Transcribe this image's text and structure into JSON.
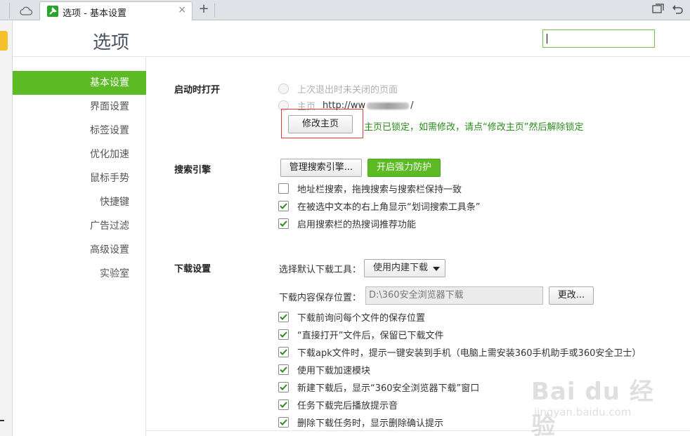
{
  "tab": {
    "title": "选项 - 基本设置",
    "close": "×",
    "new": "+"
  },
  "header": {
    "title": "选项",
    "search_value": ""
  },
  "sidebar": {
    "items": [
      {
        "label": "基本设置",
        "active": true
      },
      {
        "label": "界面设置"
      },
      {
        "label": "标签设置"
      },
      {
        "label": "优化加速"
      },
      {
        "label": "鼠标手势"
      },
      {
        "label": "快捷键"
      },
      {
        "label": "广告过滤"
      },
      {
        "label": "高级设置"
      },
      {
        "label": "实验室"
      }
    ]
  },
  "startup": {
    "title": "启动时打开",
    "option_last": "上次退出时未关闭的页面",
    "option_home_label": "主页",
    "option_home_url_start": "http://ww",
    "option_home_url_end": "/",
    "modify_home_button": "修改主页",
    "lock_note": "主页已锁定，如需修改，请点“修改主页”然后解除锁定"
  },
  "search": {
    "title": "搜索引擎",
    "manage_button": "管理搜索引擎...",
    "protect_button": "开启强力防护",
    "options": [
      {
        "label": "地址栏搜索，拖拽搜索与搜索栏保持一致",
        "checked": false
      },
      {
        "label": "在被选中文本的右上角显示“划词搜索工具条”",
        "checked": true
      },
      {
        "label": "启用搜索栏的热搜词推荐功能",
        "checked": true
      }
    ]
  },
  "download": {
    "title": "下载设置",
    "tool_label": "选择默认下载工具：",
    "tool_value": "使用内建下载",
    "path_label": "下载内容保存位置：",
    "path_value": "D:\\360安全浏览器下载",
    "change_button": "更改...",
    "options": [
      {
        "label": "下载前询问每个文件的保存位置",
        "checked": true
      },
      {
        "label": "“直接打开”文件后，保留已下载文件",
        "checked": true
      },
      {
        "label": "下载apk文件时，提示一键安装到手机（电脑上需安装360手机助手或360安全卫士）",
        "checked": true
      },
      {
        "label": "使用下载加速模块",
        "checked": true
      },
      {
        "label": "新建下载后，显示“360安全浏览器下载”窗口",
        "checked": true
      },
      {
        "label": "任务下载完后播放提示音",
        "checked": true
      },
      {
        "label": "删除下载任务时，显示删除确认提示",
        "checked": true
      }
    ]
  },
  "watermark": {
    "main": "Bai du 经验",
    "sub": "jingyan.baidu.com"
  },
  "colors": {
    "accent": "#5cbb24",
    "highlight": "#e03a3a",
    "note": "#2b8a1c"
  }
}
